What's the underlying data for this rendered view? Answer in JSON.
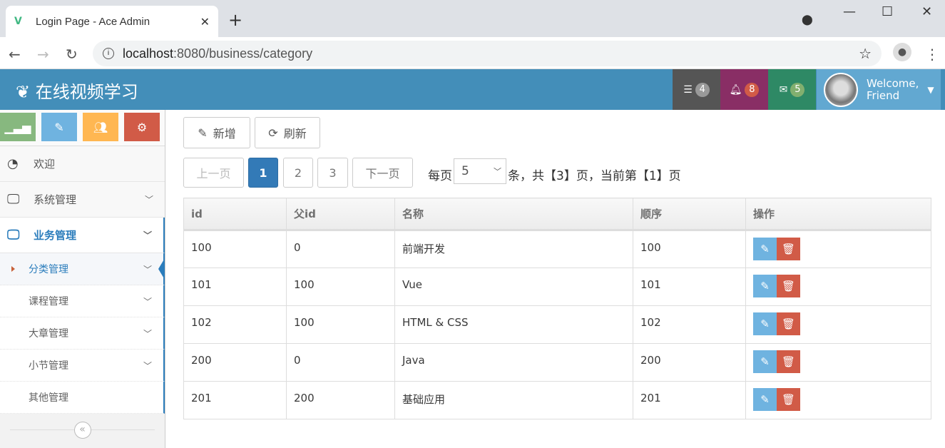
{
  "browser": {
    "tab_title": "Login Page - Ace Admin",
    "url_host": "localhost",
    "url_path": ":8080/business/category"
  },
  "navbar": {
    "brand": "在线视频学习",
    "tasks_count": "4",
    "notifications_count": "8",
    "messages_count": "5",
    "welcome": "Welcome,",
    "user": "Friend",
    "colors": {
      "bar": "#438eb9",
      "tasks": "#555555",
      "notifications": "#892e65",
      "messages": "#2e8965",
      "user": "#62a8d1"
    }
  },
  "sidebar": {
    "shortcuts": [
      {
        "icon": "signal-icon",
        "color": "#87b87f"
      },
      {
        "icon": "pencil-icon",
        "color": "#6fb3e0"
      },
      {
        "icon": "users-icon",
        "color": "#ffb752"
      },
      {
        "icon": "cogs-icon",
        "color": "#d15b47"
      }
    ],
    "items": [
      {
        "label": "欢迎",
        "icon": "dashboard-icon"
      },
      {
        "label": "系统管理",
        "icon": "desktop-icon"
      },
      {
        "label": "业务管理",
        "icon": "desktop-icon"
      }
    ],
    "subitems": [
      {
        "label": "分类管理"
      },
      {
        "label": "课程管理"
      },
      {
        "label": "大章管理"
      },
      {
        "label": "小节管理"
      },
      {
        "label": "其他管理"
      }
    ]
  },
  "toolbar": {
    "add_label": "新增",
    "refresh_label": "刷新"
  },
  "pagination": {
    "prev": "上一页",
    "pages": [
      "1",
      "2",
      "3"
    ],
    "next": "下一页",
    "per_page_prefix": "每页",
    "per_page": "5",
    "summary": "条，共【3】页，当前第【1】页"
  },
  "table": {
    "headers": [
      "id",
      "父id",
      "名称",
      "顺序",
      "操作"
    ],
    "rows": [
      [
        "100",
        "0",
        "前端开发",
        "100"
      ],
      [
        "101",
        "100",
        "Vue",
        "101"
      ],
      [
        "102",
        "100",
        "HTML & CSS",
        "102"
      ],
      [
        "200",
        "0",
        "Java",
        "200"
      ],
      [
        "201",
        "200",
        "基础应用",
        "201"
      ]
    ]
  }
}
